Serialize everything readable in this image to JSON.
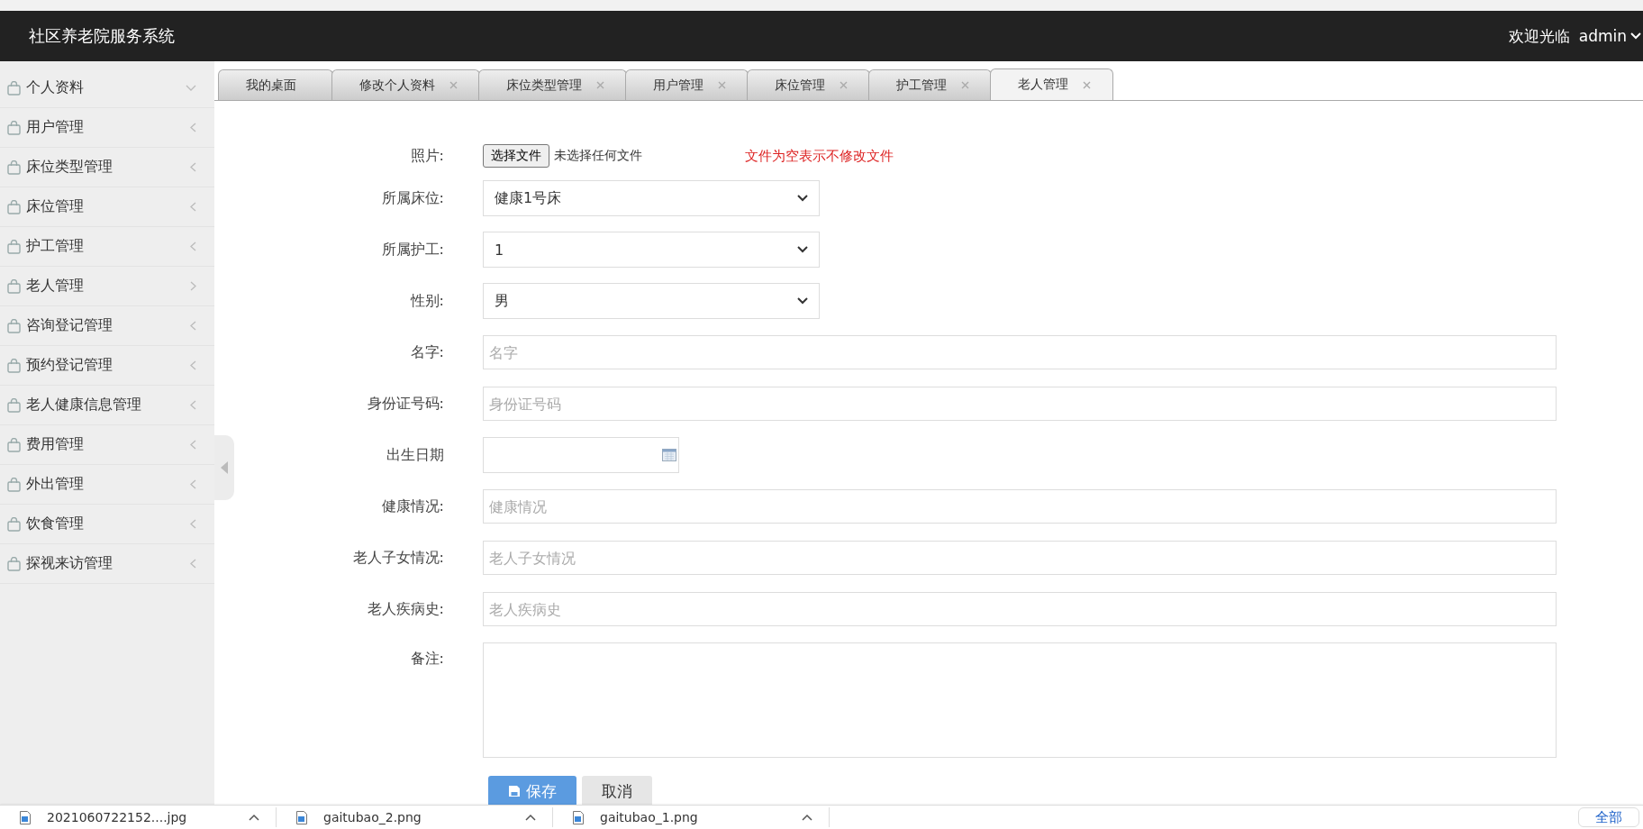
{
  "header": {
    "title": "社区养老院服务系统",
    "greeting": "欢迎光临",
    "user": "admin"
  },
  "sidebar": {
    "items": [
      {
        "label": "个人资料",
        "expanded": true
      },
      {
        "label": "用户管理",
        "expanded": false
      },
      {
        "label": "床位类型管理",
        "expanded": false
      },
      {
        "label": "床位管理",
        "expanded": false
      },
      {
        "label": "护工管理",
        "expanded": false
      },
      {
        "label": "老人管理",
        "expanded": false,
        "selected": true
      },
      {
        "label": "咨询登记管理",
        "expanded": false
      },
      {
        "label": "预约登记管理",
        "expanded": false
      },
      {
        "label": "老人健康信息管理",
        "expanded": false
      },
      {
        "label": "费用管理",
        "expanded": false
      },
      {
        "label": "外出管理",
        "expanded": false
      },
      {
        "label": "饮食管理",
        "expanded": false
      },
      {
        "label": "探视来访管理",
        "expanded": false
      }
    ]
  },
  "tabs": [
    {
      "label": "我的桌面",
      "selected": false,
      "closable": false
    },
    {
      "label": "修改个人资料",
      "selected": false,
      "closable": true
    },
    {
      "label": "床位类型管理",
      "selected": false,
      "closable": true
    },
    {
      "label": "用户管理",
      "selected": false,
      "closable": true
    },
    {
      "label": "床位管理",
      "selected": false,
      "closable": true
    },
    {
      "label": "护工管理",
      "selected": false,
      "closable": true
    },
    {
      "label": "老人管理",
      "selected": true,
      "closable": true
    }
  ],
  "form": {
    "fields": [
      {
        "kind": "file",
        "label": "照片:",
        "button": "选择文件",
        "status": "未选择任何文件",
        "note": "文件为空表示不修改文件"
      },
      {
        "kind": "select",
        "label": "所属床位:",
        "value": "健康1号床"
      },
      {
        "kind": "select",
        "label": "所属护工:",
        "value": "1"
      },
      {
        "kind": "select",
        "label": "性别:",
        "value": "男"
      },
      {
        "kind": "text",
        "label": "名字:",
        "placeholder": "名字"
      },
      {
        "kind": "text",
        "label": "身份证号码:",
        "placeholder": "身份证号码"
      },
      {
        "kind": "date",
        "label": "出生日期"
      },
      {
        "kind": "text",
        "label": "健康情况:",
        "placeholder": "健康情况"
      },
      {
        "kind": "text",
        "label": "老人子女情况:",
        "placeholder": "老人子女情况"
      },
      {
        "kind": "text",
        "label": "老人疾病史:",
        "placeholder": "老人疾病史"
      },
      {
        "kind": "textarea",
        "label": "备注:"
      }
    ],
    "buttons": [
      {
        "kind": "primary",
        "label": "保存"
      },
      {
        "kind": "default",
        "label": "取消"
      }
    ]
  },
  "downloads": {
    "files": [
      {
        "name": "2021060722152....jpg"
      },
      {
        "name": "gaitubao_2.png"
      },
      {
        "name": "gaitubao_1.png"
      }
    ],
    "show_all": "全部"
  }
}
